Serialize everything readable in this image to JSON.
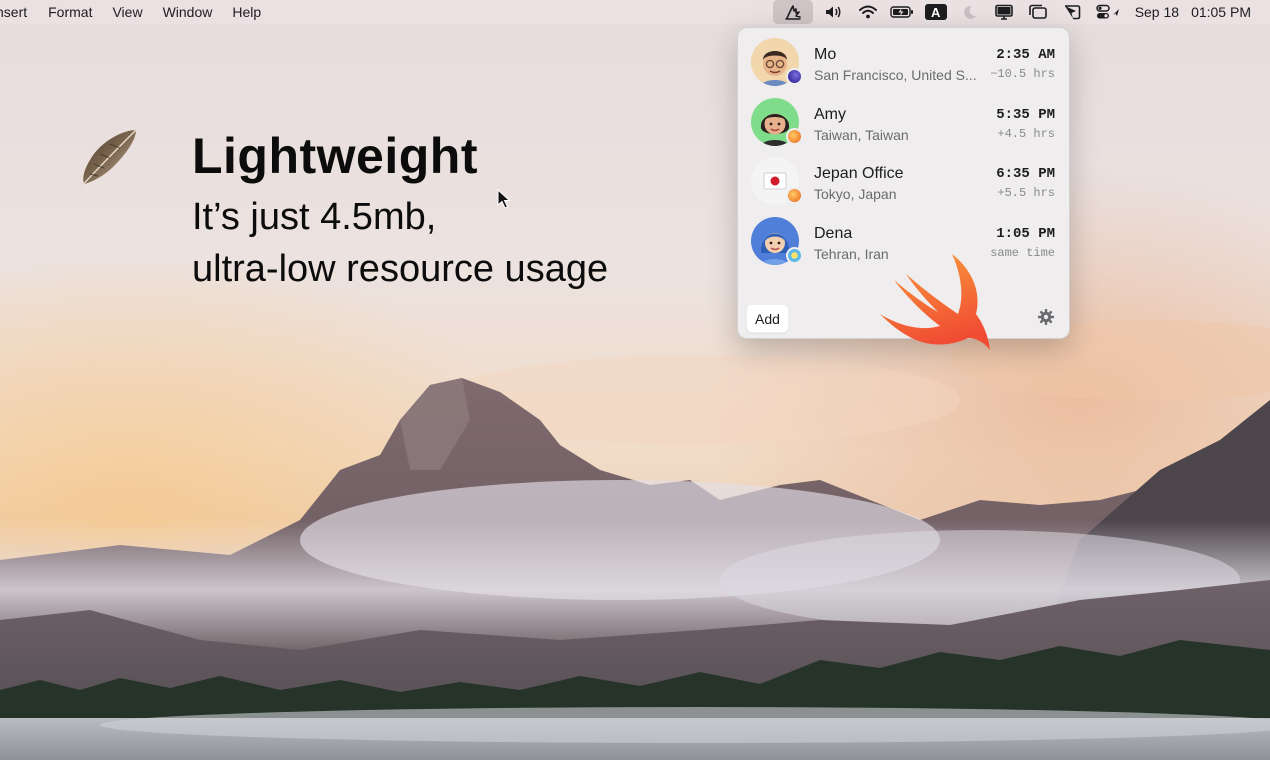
{
  "menubar": {
    "menus": [
      "nsert",
      "Format",
      "View",
      "Window",
      "Help"
    ],
    "status_icons": [
      "world-clock-icon",
      "volume-icon",
      "wifi-icon",
      "battery-charging-icon",
      "input-source-icon",
      "do-not-disturb-moon-icon",
      "display-icon",
      "window-switcher-icon",
      "screen-share-icon",
      "control-center-icon"
    ],
    "input_source_label": "A",
    "date": "Sep 18",
    "time": "01:05 PM"
  },
  "hero": {
    "title": "Lightweight",
    "line1": "It’s just 4.5mb,",
    "line2": "ultra-low resource usage",
    "illustration": "feather-icon"
  },
  "popover": {
    "contacts": [
      {
        "name": "Mo",
        "location": "San Francisco, United S...",
        "time": "2:35 AM",
        "offset": "−10.5 hrs",
        "time_of_day": "night"
      },
      {
        "name": "Amy",
        "location": "Taiwan, Taiwan",
        "time": "5:35 PM",
        "offset": "+4.5 hrs",
        "time_of_day": "evening"
      },
      {
        "name": "Jepan Office",
        "location": "Tokyo, Japan",
        "time": "6:35 PM",
        "offset": "+5.5 hrs",
        "time_of_day": "evening"
      },
      {
        "name": "Dena",
        "location": "Tehran, Iran",
        "time": "1:05 PM",
        "offset": "same time",
        "time_of_day": "day"
      }
    ],
    "add_label": "Add",
    "settings_icon": "gear-icon"
  },
  "colors": {
    "menubar_bg": "#ece0e2",
    "popover_bg": "#efedee",
    "swift_orange": "#f05138"
  }
}
